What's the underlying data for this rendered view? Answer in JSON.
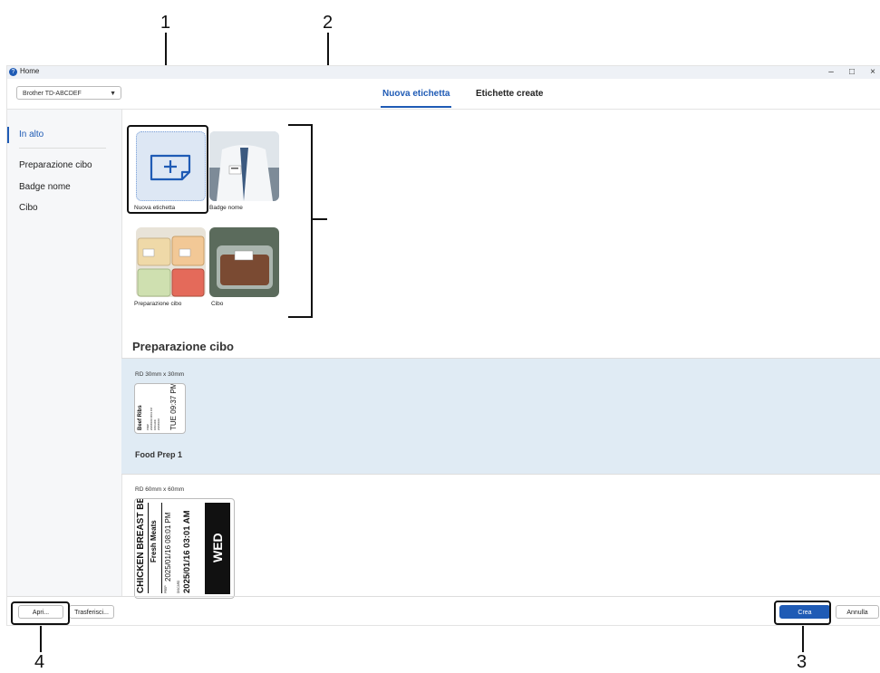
{
  "callouts": [
    "1",
    "2",
    "3",
    "4"
  ],
  "window": {
    "title": "Home",
    "app_icon": "question-circle-icon",
    "controls": {
      "minimize": "–",
      "maximize": "□",
      "close": "×"
    }
  },
  "printer": {
    "selected": "Brother TD-ABCDEF"
  },
  "tabs": [
    {
      "label": "Nuova etichetta",
      "active": true
    },
    {
      "label": "Etichette create",
      "active": false
    }
  ],
  "sidebar": {
    "items": [
      {
        "label": "In alto",
        "active": true
      },
      {
        "label": "Preparazione cibo"
      },
      {
        "label": "Badge nome"
      },
      {
        "label": "Cibo"
      }
    ]
  },
  "categories": [
    {
      "label": "Nuova etichetta",
      "icon": "new-label-icon"
    },
    {
      "label": "Badge nome",
      "image": "person-with-name-badge-photo"
    },
    {
      "label": "Preparazione cibo",
      "image": "food-containers-photo"
    },
    {
      "label": "Cibo",
      "image": "packaged-food-photo"
    }
  ],
  "section": {
    "title": "Preparazione cibo"
  },
  "templates": [
    {
      "size": "RD 30mm x 30mm",
      "name": "Food Prep 1",
      "label_text": {
        "item": "Beef Ribs",
        "line1": "PREP",
        "line2": "2025/01/16 08:01 PM",
        "line3": "DISCARD",
        "line4": "2025/01/16",
        "day_time": "TUE 09:37 PM"
      }
    },
    {
      "size": "RD 60mm x 60mm",
      "label_text": {
        "item": "CHICKEN BREAST BBQ",
        "category": "Fresh Meats",
        "prep_label": "PREP",
        "prep_time": "2025/01/16 08:01 PM",
        "discard_label": "DISCARD",
        "discard_time": "2025/01/16 03:01 AM",
        "day": "WED"
      }
    }
  ],
  "buttons": {
    "open": "Apri...",
    "transfer": "Trasferisci...",
    "create": "Crea",
    "cancel": "Annulla"
  },
  "colors": {
    "accent": "#1f5bb5",
    "band": "#e0ebf4"
  }
}
